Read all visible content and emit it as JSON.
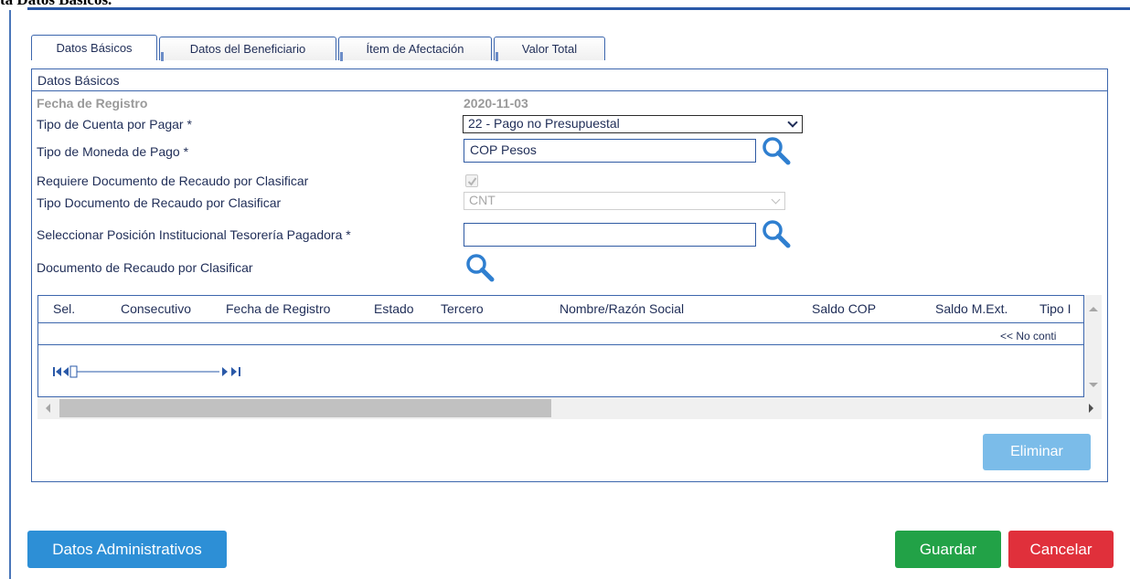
{
  "header": {
    "cut_text": "ta Datos Básicos."
  },
  "tabs": [
    {
      "label": "Datos Básicos"
    },
    {
      "label": "Datos del Beneficiario"
    },
    {
      "label": "Ítem de Afectación"
    },
    {
      "label": "Valor Total"
    }
  ],
  "panel": {
    "title": "Datos Básicos"
  },
  "form": {
    "fecha_registro": {
      "label": "Fecha de Registro",
      "value": "2020-11-03"
    },
    "tipo_cuenta": {
      "label": "Tipo de Cuenta por Pagar *",
      "value": "22 - Pago no Presupuestal"
    },
    "tipo_moneda": {
      "label": "Tipo de Moneda de Pago *",
      "value": "COP Pesos"
    },
    "requiere_doc": {
      "label": "Requiere Documento de Recaudo por Clasificar",
      "checked": true
    },
    "tipo_doc": {
      "label": "Tipo Documento de Recaudo por Clasificar",
      "value": "CNT"
    },
    "posicion_tesoreria": {
      "label": "Seleccionar Posición Institucional Tesorería Pagadora *",
      "value": ""
    },
    "doc_recaudo": {
      "label": "Documento de Recaudo por Clasificar"
    }
  },
  "grid": {
    "columns": [
      "Sel.",
      "Consecutivo",
      "Fecha de Registro",
      "Estado",
      "Tercero",
      "Nombre/Razón Social",
      "Saldo COP",
      "Saldo M.Ext.",
      "Tipo I"
    ],
    "no_data": "<< No conti"
  },
  "buttons": {
    "eliminar": "Eliminar",
    "datos_admin": "Datos Administrativos",
    "guardar": "Guardar",
    "cancelar": "Cancelar"
  },
  "colors": {
    "accent": "#3c66ad",
    "primary_button": "#2d8fd6",
    "success_button": "#22a247",
    "danger_button": "#e0303b",
    "disabled_button": "#7bbce9"
  }
}
